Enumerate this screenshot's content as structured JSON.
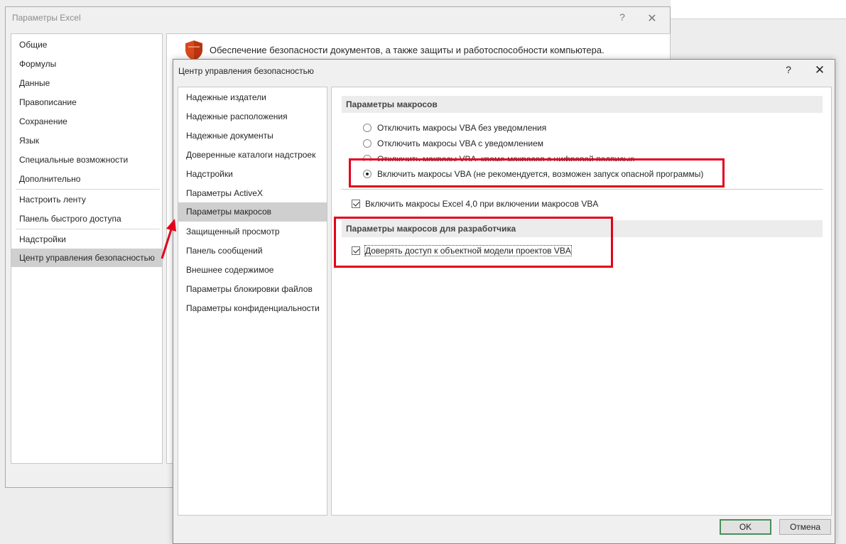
{
  "back_window": {
    "title": "Параметры Excel",
    "help": "?",
    "close": "✕",
    "nav_items": [
      "Общие",
      "Формулы",
      "Данные",
      "Правописание",
      "Сохранение",
      "Язык",
      "Специальные возможности",
      "Дополнительно",
      "Настроить ленту",
      "Панель быстрого доступа",
      "Надстройки",
      "Центр управления безопасностью"
    ],
    "selected_nav": "Центр управления безопасностью",
    "main_text": "Обеспечение безопасности документов, а также защиты и работоспособности компьютера.",
    "main_icon": "shield-icon"
  },
  "front_window": {
    "title": "Центр управления безопасностью",
    "help": "?",
    "close": "✕",
    "nav_items": [
      "Надежные издатели",
      "Надежные расположения",
      "Надежные документы",
      "Доверенные каталоги надстроек",
      "Надстройки",
      "Параметры ActiveX",
      "Параметры макросов",
      "Защищенный просмотр",
      "Панель сообщений",
      "Внешнее содержимое",
      "Параметры блокировки файлов",
      "Параметры конфиденциальности"
    ],
    "selected_nav": "Параметры макросов",
    "macro_settings": {
      "header": "Параметры макросов",
      "options": [
        {
          "label": "Отключить макросы VBA без уведомления",
          "checked": false
        },
        {
          "label": "Отключить макросы VBA с уведомлением",
          "checked": false
        },
        {
          "label": "Отключить макросы VBA, кроме макросов с цифровой подписью",
          "checked": false
        },
        {
          "label": "Включить макросы VBA (не рекомендуется, возможен запуск опасной программы)",
          "checked": true
        }
      ],
      "excel4_checkbox": {
        "label": "Включить макросы Excel 4,0 при включении макросов VBA",
        "checked": true
      }
    },
    "developer_settings": {
      "header": "Параметры макросов для разработчика",
      "trust_vba_checkbox": {
        "label": "Доверять доступ к объектной модели проектов VBA",
        "checked": true
      }
    },
    "buttons": {
      "ok": "OK",
      "cancel": "Отмена"
    }
  },
  "colors": {
    "annotation_red": "#e3001b",
    "selected_bg": "#cfcfcf",
    "shield_orange": "#d9481c"
  }
}
